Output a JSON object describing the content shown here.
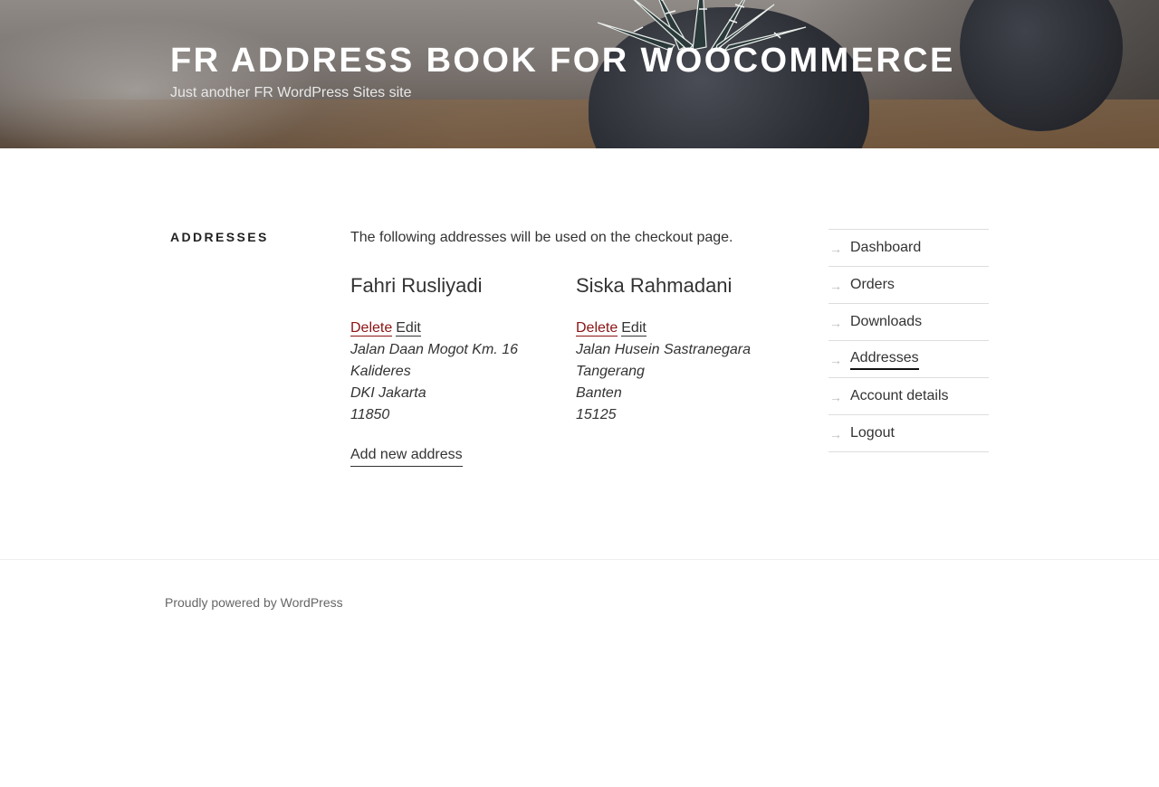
{
  "site": {
    "title": "FR ADDRESS BOOK FOR WOOCOMMERCE",
    "description": "Just another FR WordPress Sites site"
  },
  "main": {
    "heading": "ADDRESSES",
    "intro": "The following addresses will be used on the checkout page.",
    "addresses": [
      {
        "name": "Fahri Rusliyadi",
        "delete_label": "Delete",
        "edit_label": "Edit",
        "lines": [
          "Jalan Daan Mogot Km. 16",
          "Kalideres",
          "DKI Jakarta",
          "11850"
        ]
      },
      {
        "name": "Siska Rahmadani",
        "delete_label": "Delete",
        "edit_label": "Edit",
        "lines": [
          "Jalan Husein Sastranegara",
          "Tangerang",
          "Banten",
          "15125"
        ]
      }
    ],
    "add_new_label": "Add new address"
  },
  "account_nav": {
    "arrow_glyph": "→",
    "active": "Addresses",
    "items": [
      "Dashboard",
      "Orders",
      "Downloads",
      "Addresses",
      "Account details",
      "Logout"
    ]
  },
  "footer": {
    "text": "Proudly powered by WordPress"
  },
  "colors": {
    "delete_link": "#8a1414",
    "text": "#333333",
    "divider": "#dddddd"
  }
}
